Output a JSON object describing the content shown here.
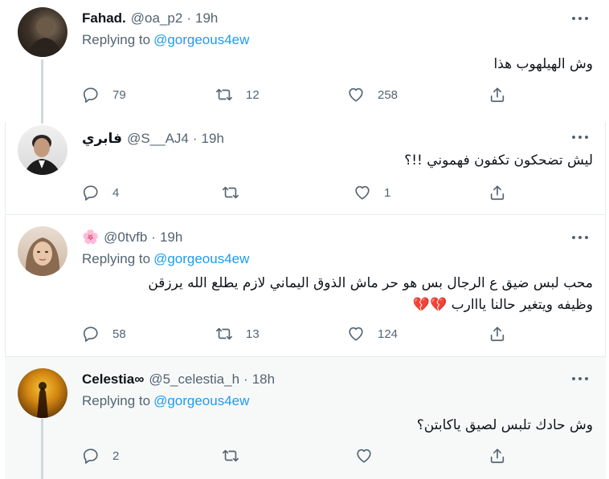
{
  "tweets": [
    {
      "name": "Fahad.",
      "handle": "@oa_p2",
      "time": "19h",
      "replying_label": "Replying to",
      "replying_to": "@gorgeous4ew",
      "lines": [
        "وش الهيلهوب هذا"
      ],
      "replies": "79",
      "retweets": "12",
      "likes": "258"
    },
    {
      "name": "فابري",
      "handle": "@S__AJ4",
      "time": "19h",
      "lines": [
        "ليش تضحكون تكفون فهموني !!؟"
      ],
      "replies": "4",
      "retweets": "",
      "likes": "1"
    },
    {
      "name_emoji": "🌸",
      "handle": "@0tvfb",
      "time": "19h",
      "replying_label": "Replying to",
      "replying_to": "@gorgeous4ew",
      "lines": [
        "محب لبس ضيق ع الرجال بس هو حر ماش الذوق اليماني لازم يطلع الله يرزقن",
        "وظيفه ويتغير حالنا يااارب 💔💔"
      ],
      "replies": "58",
      "retweets": "13",
      "likes": "124"
    },
    {
      "name": "Celestia∞",
      "handle": "@5_celestia_h",
      "time": "18h",
      "replying_label": "Replying to",
      "replying_to": "@gorgeous4ew",
      "lines": [
        "وش حادك تلبس لصيق ياكابتن؟"
      ],
      "replies": "2",
      "retweets": "",
      "likes": ""
    }
  ],
  "icons": {
    "reply": "reply-icon",
    "retweet": "retweet-icon",
    "like": "heart-icon",
    "share": "share-icon",
    "more": "more-icon"
  },
  "colors": {
    "link": "#1d9bf0",
    "muted": "#536471",
    "thread_line": "#cfd9de",
    "highlight_bg": "#f7f9f9"
  }
}
